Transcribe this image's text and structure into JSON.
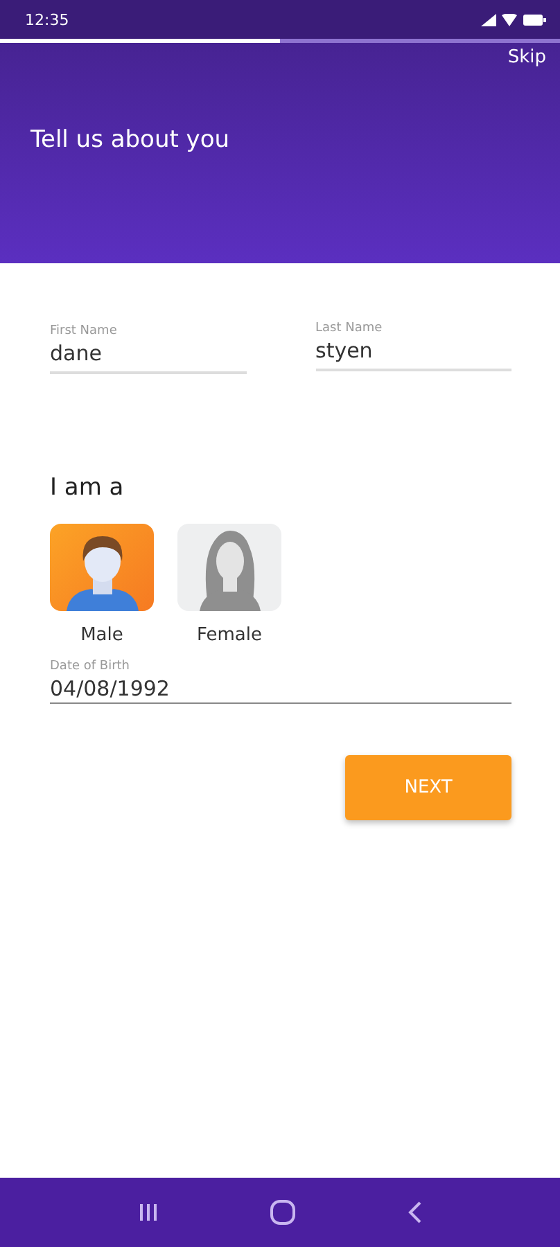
{
  "status_bar": {
    "time": "12:35"
  },
  "progress": {
    "level": 0.5
  },
  "header": {
    "skip": "Skip",
    "title": "Tell us about you"
  },
  "fields": [
    {
      "label": "First Name",
      "value": "dane"
    },
    {
      "label": "Last Name",
      "value": "styen"
    }
  ],
  "gender": {
    "heading": "I am a",
    "options": [
      {
        "label": "Male",
        "selected": true,
        "kind": "male"
      },
      {
        "label": "Female",
        "selected": false,
        "kind": "female"
      }
    ]
  },
  "birth": {
    "label": "Date of Birth",
    "value": "04/08/1992"
  },
  "next_button": "NEXT"
}
